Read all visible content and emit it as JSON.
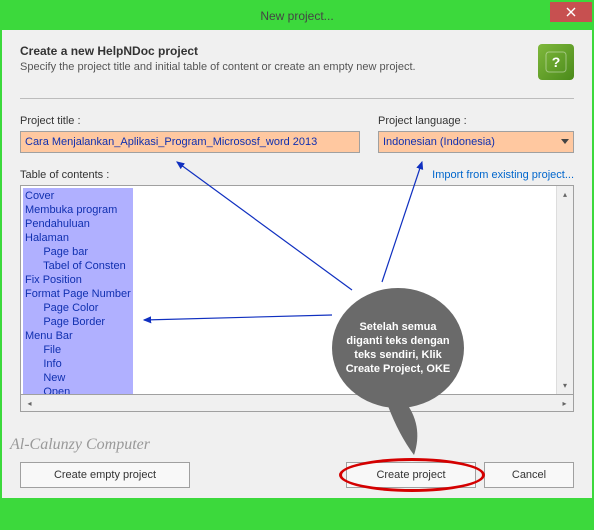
{
  "window": {
    "title": "New project..."
  },
  "header": {
    "title": "Create a new HelpNDoc project",
    "subtitle": "Specify the project title and initial table of content or create an empty new project."
  },
  "form": {
    "title_label": "Project title :",
    "title_value": "Cara Menjalankan_Aplikasi_Program_Micrososf_word 2013",
    "lang_label": "Project language :",
    "lang_value": "Indonesian (Indonesia)"
  },
  "toc": {
    "label": "Table of contents :",
    "import_link": "Import from existing project...",
    "items": [
      {
        "indent": 0,
        "text": "Cover"
      },
      {
        "indent": 0,
        "text": "Membuka program"
      },
      {
        "indent": 0,
        "text": "Pendahuluan"
      },
      {
        "indent": 0,
        "text": "Halaman"
      },
      {
        "indent": 1,
        "text": "Page bar"
      },
      {
        "indent": 1,
        "text": "Tabel of Consten"
      },
      {
        "indent": 0,
        "text": "Fix Position"
      },
      {
        "indent": 0,
        "text": "Format Page Number"
      },
      {
        "indent": 1,
        "text": "Page Color"
      },
      {
        "indent": 1,
        "text": "Page Border"
      },
      {
        "indent": 0,
        "text": "Menu Bar"
      },
      {
        "indent": 1,
        "text": "File"
      },
      {
        "indent": 1,
        "text": "Info"
      },
      {
        "indent": 1,
        "text": "New"
      },
      {
        "indent": 1,
        "text": "Open"
      }
    ]
  },
  "buttons": {
    "empty": "Create empty project",
    "create": "Create project",
    "cancel": "Cancel"
  },
  "annotation": {
    "bubble": "Setelah semua diganti teks dengan teks sendiri, Klik Create Project, OKE"
  },
  "watermark": "Al-Calunzy Computer",
  "icons": {
    "app": "?"
  }
}
